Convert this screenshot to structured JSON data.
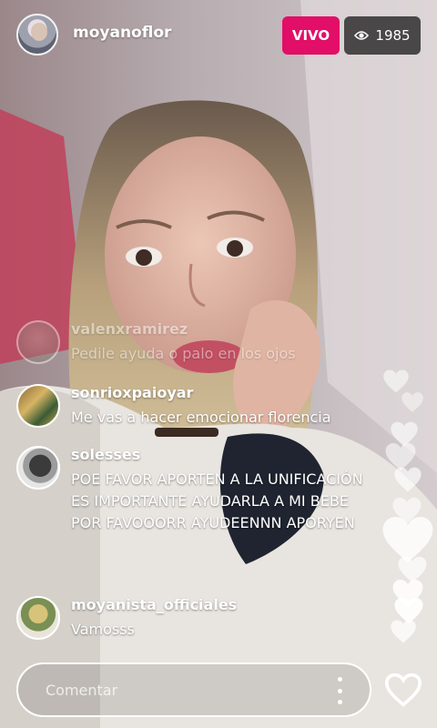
{
  "header": {
    "username": "moyanoflor",
    "live_label": "VIVO",
    "viewer_count": "1985",
    "viewer_icon": "eye-icon"
  },
  "comments": [
    {
      "user": "valenxramirez",
      "text": "Pedile ayuda o palo en los ojos",
      "faded": true
    },
    {
      "user": "sonrioxpaioyar",
      "text": "Me vas a hacer emocionar florencia"
    },
    {
      "user": "solesses",
      "text": "POE FAVOR APORTEN A LA UNIFICACIÓN ES IMPORTANTE AYUDARLA A MI BEBE POR FAVOOORR AYUDEENNN APORYEN"
    },
    {
      "user": "moyanista_officiales",
      "text": "Vamosss"
    }
  ],
  "footer": {
    "comment_placeholder": "Comentar",
    "more_icon": "more-vertical-icon",
    "like_icon": "heart-outline-icon"
  },
  "colors": {
    "live_badge": "#e20e67",
    "viewer_badge": "#2a2a2a",
    "text": "#ffffff"
  }
}
